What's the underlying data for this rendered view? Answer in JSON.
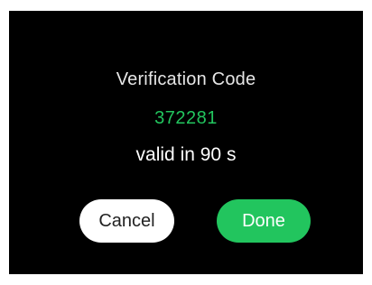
{
  "dialog": {
    "title": "Verification Code",
    "code": "372281",
    "validity_text": "valid in 90 s",
    "cancel_label": "Cancel",
    "done_label": "Done"
  },
  "colors": {
    "background": "#000000",
    "accent": "#22c55e",
    "title_text": "#e6e6e6",
    "cancel_button_bg": "#ffffff"
  }
}
